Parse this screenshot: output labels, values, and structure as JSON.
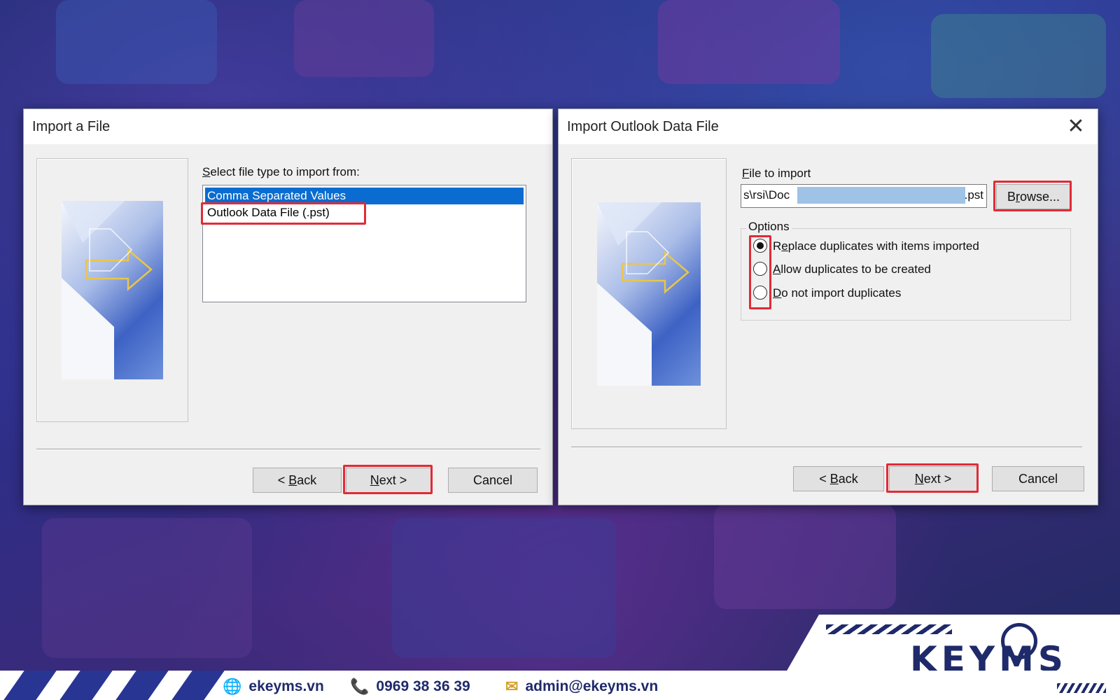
{
  "dialog_left": {
    "title": "Import a File",
    "prompt_hotkey": "S",
    "prompt_rest": "elect file type to import from:",
    "list_items": [
      "Comma Separated Values",
      "Outlook Data File (.pst)"
    ],
    "back_lt": "< ",
    "back_hotkey": "B",
    "back_rest": "ack",
    "next_hotkey": "N",
    "next_rest": "ext >",
    "cancel_label": "Cancel"
  },
  "dialog_right": {
    "title": "Import Outlook Data File",
    "close_glyph": "✕",
    "file_label_hotkey": "F",
    "file_label_rest": "ile to import",
    "file_value_start": "s\\rsi\\Doc",
    "file_value_end": ".pst",
    "browse_hotkey": "r",
    "browse_pre": "B",
    "browse_rest": "owse...",
    "options_label": "Options",
    "options": [
      {
        "pre": "R",
        "hotkey": "e",
        "rest": "place duplicates with items imported",
        "selected": true
      },
      {
        "pre": "",
        "hotkey": "A",
        "rest": "llow duplicates to be created",
        "selected": false
      },
      {
        "pre": "",
        "hotkey": "D",
        "rest": "o not import duplicates",
        "selected": false
      }
    ],
    "back_lt": "< ",
    "back_hotkey": "B",
    "back_rest": "ack",
    "next_hotkey": "N",
    "next_rest": "ext >",
    "cancel_label": "Cancel"
  },
  "footer": {
    "website": "ekeyms.vn",
    "phone": "0969 38 36 39",
    "email": "admin@ekeyms.vn",
    "logo_text": "KEYMS"
  },
  "colors": {
    "highlight_red": "#e12b36",
    "selection_blue": "#0a6cd0",
    "brand_navy": "#1f2a6b",
    "brand_gold": "#d4a12a"
  }
}
